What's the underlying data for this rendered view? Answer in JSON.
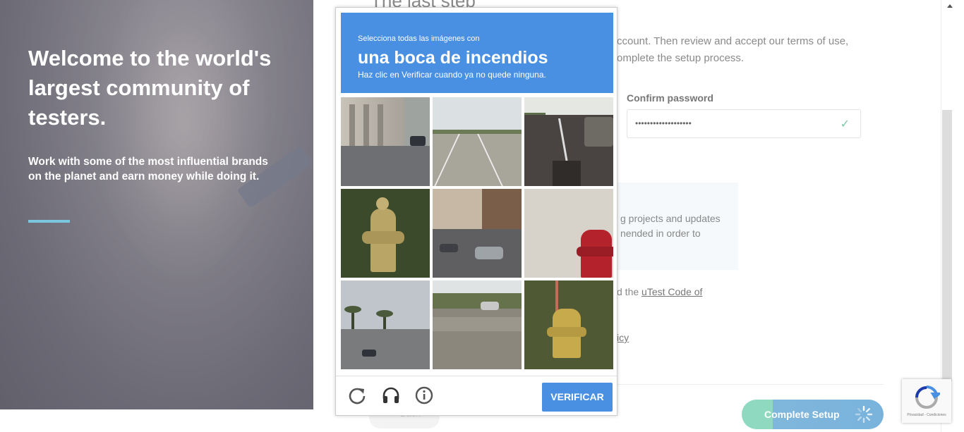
{
  "hero": {
    "headline": "Welcome to the world's largest community of testers.",
    "subline": "Work with some of the most influential brands on the planet and earn money while doing it."
  },
  "form": {
    "title": "The last step",
    "intro": "ccount. Then review and accept our terms of use, omplete the setup process.",
    "confirm_label": "Confirm password",
    "confirm_value": "•••••••••••••••••••",
    "info_text": "g projects and updates nended in order to",
    "code_prefix": "d the ",
    "code_link": "uTest Code of",
    "policy_link": "icy",
    "back_label": "← Back",
    "complete_label": "Complete Setup"
  },
  "captcha": {
    "line1": "Selecciona todas las imágenes con",
    "line2": "una boca de incendios",
    "line3": "Haz clic en Verificar cuando ya no quede ninguna.",
    "verify_label": "VERIFICAR",
    "icons": [
      "reload-icon",
      "headphones-icon",
      "info-icon"
    ]
  },
  "recaptcha_badge": {
    "text": "Privacidad - Condiciones"
  },
  "colors": {
    "captcha_blue": "#4a90e2",
    "accent": "#7cc7e0",
    "complete_green": "#8fd9c0",
    "complete_blue": "#79b3dc"
  }
}
